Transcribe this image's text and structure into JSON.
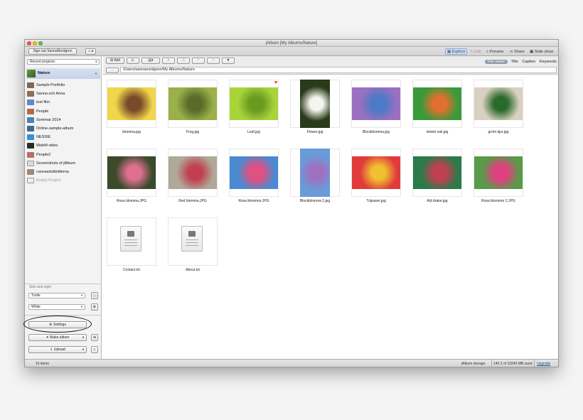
{
  "window": {
    "title": "jAlbum [My Albums/Nature]"
  },
  "toolbar": {
    "sign_out_label": "Sign out SannaNordgren",
    "views": [
      "Explore",
      "Edit",
      "Preview",
      "Share",
      "Slide show"
    ],
    "add_label": "Add"
  },
  "sidebar": {
    "recent_projects_label": "Recent projects:",
    "selected_project": "Nature",
    "projects": [
      {
        "name": "Sample Portfolio",
        "color": "#7a6a5a"
      },
      {
        "name": "Sanna och Anna",
        "color": "#8a6f55"
      },
      {
        "name": "test film",
        "color": "#5a8ac8"
      },
      {
        "name": "People",
        "color": "#b06a4a"
      },
      {
        "name": "Sommar 2014",
        "color": "#4f7fb8"
      },
      {
        "name": "Online-sample-album",
        "color": "#3d6b91"
      },
      {
        "name": "NESSIE",
        "color": "#3f8fd0"
      },
      {
        "name": "WebM video",
        "color": "#2a2a2a"
      },
      {
        "name": "People2",
        "color": "#b37060"
      },
      {
        "name": "Screenshots of jAlbum",
        "color": "#dadada"
      },
      {
        "name": "canvasdukbilderna",
        "color": "#9a8a7a"
      },
      {
        "name": "Empty Project",
        "color": "#eeeeee"
      }
    ],
    "skin_and_style_label": "Skin and style",
    "skin_value": "Turtle",
    "style_value": "White",
    "settings_label": "Settings",
    "make_album_label": "Make album",
    "upload_label": "Upload"
  },
  "pathbar": {
    "path": "/Users/sannanordgren/My Albums/Nature",
    "sort_options": [
      "File name",
      "Title",
      "Caption",
      "Keywords"
    ],
    "active_sort": "File name"
  },
  "files": [
    {
      "name": "blomma.jpg",
      "c1": "#f0d64a",
      "c2": "#7a4a2a"
    },
    {
      "name": "Frog.jpg",
      "c1": "#9bb04a",
      "c2": "#5a6a2a"
    },
    {
      "name": "Leaf.jpg",
      "c1": "#a8d43a",
      "c2": "#6a9a20"
    },
    {
      "name": "Flower.jpg",
      "c1": "#2a3a1a",
      "c2": "#f5f5f0"
    },
    {
      "name": "Blockblomma.jpg",
      "c1": "#9a70c0",
      "c2": "#4a7ac8"
    },
    {
      "name": "okänd sak.jpg",
      "c1": "#3a9a3a",
      "c2": "#e07030"
    },
    {
      "name": "grönt djur.jpg",
      "c1": "#d8d0c0",
      "c2": "#2a6a2a"
    },
    {
      "name": "Rosa blomma.JPG",
      "c1": "#3a4a2a",
      "c2": "#e07090"
    },
    {
      "name": "Red blomma.JPG",
      "c1": "#b0a898",
      "c2": "#c04050"
    },
    {
      "name": "Rosa blommor.JPG",
      "c1": "#4a8ad0",
      "c2": "#e05080"
    },
    {
      "name": "Blockblomma 2.jpg",
      "c1": "#6a9ad8",
      "c2": "#a070c0"
    },
    {
      "name": "Tulpaner.jpg",
      "c1": "#e03a3a",
      "c2": "#f0c030"
    },
    {
      "name": "Ald drake.jpg",
      "c1": "#2a7a4a",
      "c2": "#c04050"
    },
    {
      "name": "Rosa blommor 2.JPG",
      "c1": "#5a9a4a",
      "c2": "#e04080"
    },
    {
      "name": "Contact.txt",
      "doc": true
    },
    {
      "name": "About.txt",
      "doc": true
    }
  ],
  "status": {
    "item_count": "16 items",
    "storage_label": "jAlbum storage",
    "storage_usage": "140.2 of 10240 MB used",
    "upgrade_label": "Upgrade"
  },
  "colors": {
    "accent": "#1c4e99",
    "heart": "#d22a2a"
  }
}
